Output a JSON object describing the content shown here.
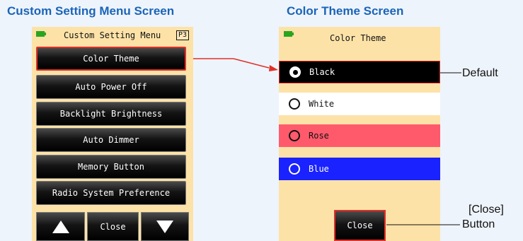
{
  "headings": {
    "left": "Custom Setting Menu Screen",
    "right": "Color Theme Screen"
  },
  "menu_screen": {
    "title": "Custom Setting Menu",
    "page_badge": "P3",
    "items": [
      {
        "label": "Color Theme",
        "selected": true
      },
      {
        "label": "Auto Power Off"
      },
      {
        "label": "Backlight Brightness"
      },
      {
        "label": "Auto Dimmer"
      },
      {
        "label": "Memory Button"
      },
      {
        "label": "Radio System Preference"
      }
    ],
    "bottom_bar": {
      "up_icon": "arrow-up-icon",
      "close_label": "Close",
      "down_icon": "arrow-down-icon"
    }
  },
  "theme_screen": {
    "title": "Color Theme",
    "options": [
      {
        "label": "Black",
        "selected": true,
        "bg": "#000000",
        "fg": "#ffffff"
      },
      {
        "label": "White",
        "selected": false,
        "bg": "#ffffff",
        "fg": "#111111"
      },
      {
        "label": "Rose",
        "selected": false,
        "bg": "#ff5a6c",
        "fg": "#111111"
      },
      {
        "label": "Blue",
        "selected": false,
        "bg": "#1a22ff",
        "fg": "#ffffff"
      }
    ],
    "close_label": "Close"
  },
  "callouts": {
    "default": "Default",
    "close_line1": "[Close]",
    "close_line2": "Button"
  },
  "colors": {
    "heading": "#1a64b8",
    "screen_bg": "#fde2a8",
    "highlight": "#e03028"
  }
}
